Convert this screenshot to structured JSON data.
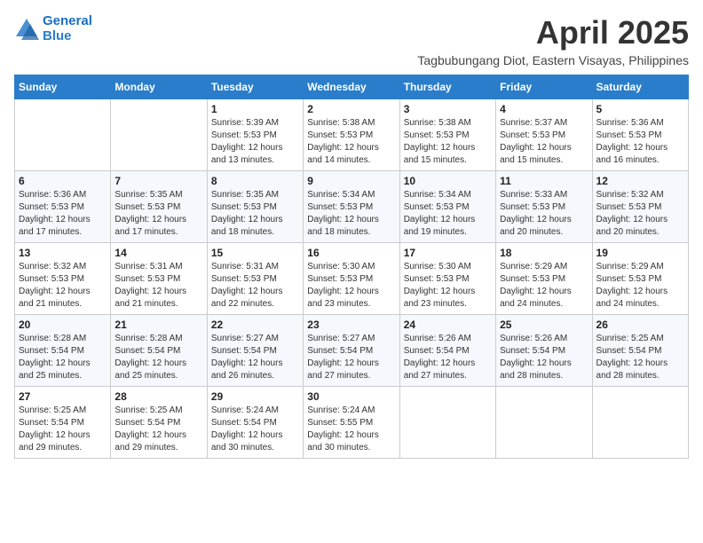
{
  "header": {
    "logo_line1": "General",
    "logo_line2": "Blue",
    "month_year": "April 2025",
    "location": "Tagbubungang Diot, Eastern Visayas, Philippines"
  },
  "weekdays": [
    "Sunday",
    "Monday",
    "Tuesday",
    "Wednesday",
    "Thursday",
    "Friday",
    "Saturday"
  ],
  "weeks": [
    [
      {
        "day": "",
        "info": ""
      },
      {
        "day": "",
        "info": ""
      },
      {
        "day": "1",
        "info": "Sunrise: 5:39 AM\nSunset: 5:53 PM\nDaylight: 12 hours\nand 13 minutes."
      },
      {
        "day": "2",
        "info": "Sunrise: 5:38 AM\nSunset: 5:53 PM\nDaylight: 12 hours\nand 14 minutes."
      },
      {
        "day": "3",
        "info": "Sunrise: 5:38 AM\nSunset: 5:53 PM\nDaylight: 12 hours\nand 15 minutes."
      },
      {
        "day": "4",
        "info": "Sunrise: 5:37 AM\nSunset: 5:53 PM\nDaylight: 12 hours\nand 15 minutes."
      },
      {
        "day": "5",
        "info": "Sunrise: 5:36 AM\nSunset: 5:53 PM\nDaylight: 12 hours\nand 16 minutes."
      }
    ],
    [
      {
        "day": "6",
        "info": "Sunrise: 5:36 AM\nSunset: 5:53 PM\nDaylight: 12 hours\nand 17 minutes."
      },
      {
        "day": "7",
        "info": "Sunrise: 5:35 AM\nSunset: 5:53 PM\nDaylight: 12 hours\nand 17 minutes."
      },
      {
        "day": "8",
        "info": "Sunrise: 5:35 AM\nSunset: 5:53 PM\nDaylight: 12 hours\nand 18 minutes."
      },
      {
        "day": "9",
        "info": "Sunrise: 5:34 AM\nSunset: 5:53 PM\nDaylight: 12 hours\nand 18 minutes."
      },
      {
        "day": "10",
        "info": "Sunrise: 5:34 AM\nSunset: 5:53 PM\nDaylight: 12 hours\nand 19 minutes."
      },
      {
        "day": "11",
        "info": "Sunrise: 5:33 AM\nSunset: 5:53 PM\nDaylight: 12 hours\nand 20 minutes."
      },
      {
        "day": "12",
        "info": "Sunrise: 5:32 AM\nSunset: 5:53 PM\nDaylight: 12 hours\nand 20 minutes."
      }
    ],
    [
      {
        "day": "13",
        "info": "Sunrise: 5:32 AM\nSunset: 5:53 PM\nDaylight: 12 hours\nand 21 minutes."
      },
      {
        "day": "14",
        "info": "Sunrise: 5:31 AM\nSunset: 5:53 PM\nDaylight: 12 hours\nand 21 minutes."
      },
      {
        "day": "15",
        "info": "Sunrise: 5:31 AM\nSunset: 5:53 PM\nDaylight: 12 hours\nand 22 minutes."
      },
      {
        "day": "16",
        "info": "Sunrise: 5:30 AM\nSunset: 5:53 PM\nDaylight: 12 hours\nand 23 minutes."
      },
      {
        "day": "17",
        "info": "Sunrise: 5:30 AM\nSunset: 5:53 PM\nDaylight: 12 hours\nand 23 minutes."
      },
      {
        "day": "18",
        "info": "Sunrise: 5:29 AM\nSunset: 5:53 PM\nDaylight: 12 hours\nand 24 minutes."
      },
      {
        "day": "19",
        "info": "Sunrise: 5:29 AM\nSunset: 5:53 PM\nDaylight: 12 hours\nand 24 minutes."
      }
    ],
    [
      {
        "day": "20",
        "info": "Sunrise: 5:28 AM\nSunset: 5:54 PM\nDaylight: 12 hours\nand 25 minutes."
      },
      {
        "day": "21",
        "info": "Sunrise: 5:28 AM\nSunset: 5:54 PM\nDaylight: 12 hours\nand 25 minutes."
      },
      {
        "day": "22",
        "info": "Sunrise: 5:27 AM\nSunset: 5:54 PM\nDaylight: 12 hours\nand 26 minutes."
      },
      {
        "day": "23",
        "info": "Sunrise: 5:27 AM\nSunset: 5:54 PM\nDaylight: 12 hours\nand 27 minutes."
      },
      {
        "day": "24",
        "info": "Sunrise: 5:26 AM\nSunset: 5:54 PM\nDaylight: 12 hours\nand 27 minutes."
      },
      {
        "day": "25",
        "info": "Sunrise: 5:26 AM\nSunset: 5:54 PM\nDaylight: 12 hours\nand 28 minutes."
      },
      {
        "day": "26",
        "info": "Sunrise: 5:25 AM\nSunset: 5:54 PM\nDaylight: 12 hours\nand 28 minutes."
      }
    ],
    [
      {
        "day": "27",
        "info": "Sunrise: 5:25 AM\nSunset: 5:54 PM\nDaylight: 12 hours\nand 29 minutes."
      },
      {
        "day": "28",
        "info": "Sunrise: 5:25 AM\nSunset: 5:54 PM\nDaylight: 12 hours\nand 29 minutes."
      },
      {
        "day": "29",
        "info": "Sunrise: 5:24 AM\nSunset: 5:54 PM\nDaylight: 12 hours\nand 30 minutes."
      },
      {
        "day": "30",
        "info": "Sunrise: 5:24 AM\nSunset: 5:55 PM\nDaylight: 12 hours\nand 30 minutes."
      },
      {
        "day": "",
        "info": ""
      },
      {
        "day": "",
        "info": ""
      },
      {
        "day": "",
        "info": ""
      }
    ]
  ]
}
